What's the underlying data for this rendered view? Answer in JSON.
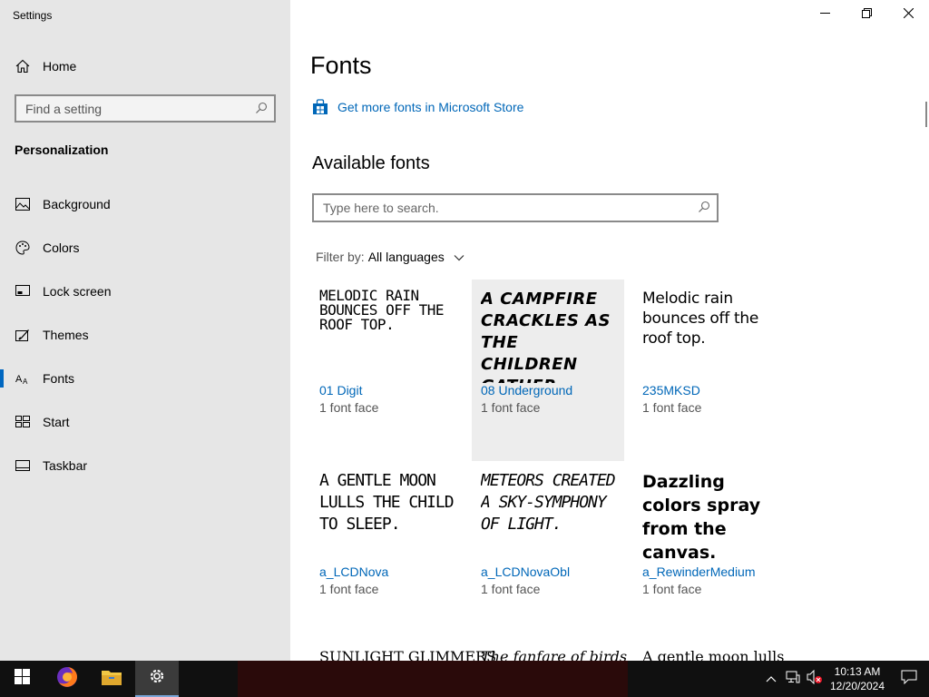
{
  "window": {
    "title": "Settings",
    "controls": [
      "minimize",
      "restore",
      "close"
    ]
  },
  "sidebar": {
    "home_label": "Home",
    "search_placeholder": "Find a setting",
    "section_title": "Personalization",
    "items": [
      {
        "label": "Background",
        "icon": "image-icon"
      },
      {
        "label": "Colors",
        "icon": "palette-icon"
      },
      {
        "label": "Lock screen",
        "icon": "lock-screen-icon"
      },
      {
        "label": "Themes",
        "icon": "themes-icon"
      },
      {
        "label": "Fonts",
        "icon": "fonts-icon",
        "selected": true
      },
      {
        "label": "Start",
        "icon": "start-icon"
      },
      {
        "label": "Taskbar",
        "icon": "taskbar-icon"
      }
    ]
  },
  "main": {
    "page_title": "Fonts",
    "store_link": "Get more fonts in Microsoft Store",
    "available_title": "Available fonts",
    "search_placeholder": "Type here to search.",
    "filter_label": "Filter by:",
    "filter_value": "All languages",
    "fonts": [
      {
        "preview": "Melodic rain bounces off the roof top.",
        "name": "01 Digit",
        "faces": "1 font face"
      },
      {
        "preview": "A campfire crackles as the children gather.",
        "name": "08 Underground",
        "faces": "1 font face"
      },
      {
        "preview": "Melodic rain bounces off the roof top.",
        "name": "235MKSD",
        "faces": "1 font face"
      },
      {
        "preview": "A gentle moon lulls the child to sleep.",
        "name": "a_LCDNova",
        "faces": "1 font face"
      },
      {
        "preview": "Meteors created a sky-symphony of light.",
        "name": "a_LCDNovaObl",
        "faces": "1 font face"
      },
      {
        "preview": "Dazzling colors spray from the canvas.",
        "name": "a_RewinderMedium",
        "faces": "1 font face"
      }
    ],
    "next_row_previews": [
      "SUNLIGHT GLIMMERS",
      "The fanfare of birds",
      "A gentle moon lulls the"
    ]
  },
  "taskbar": {
    "apps": [
      "firefox-icon",
      "file-explorer-icon",
      "settings-icon"
    ],
    "time": "10:13 AM",
    "date": "12/20/2024"
  }
}
